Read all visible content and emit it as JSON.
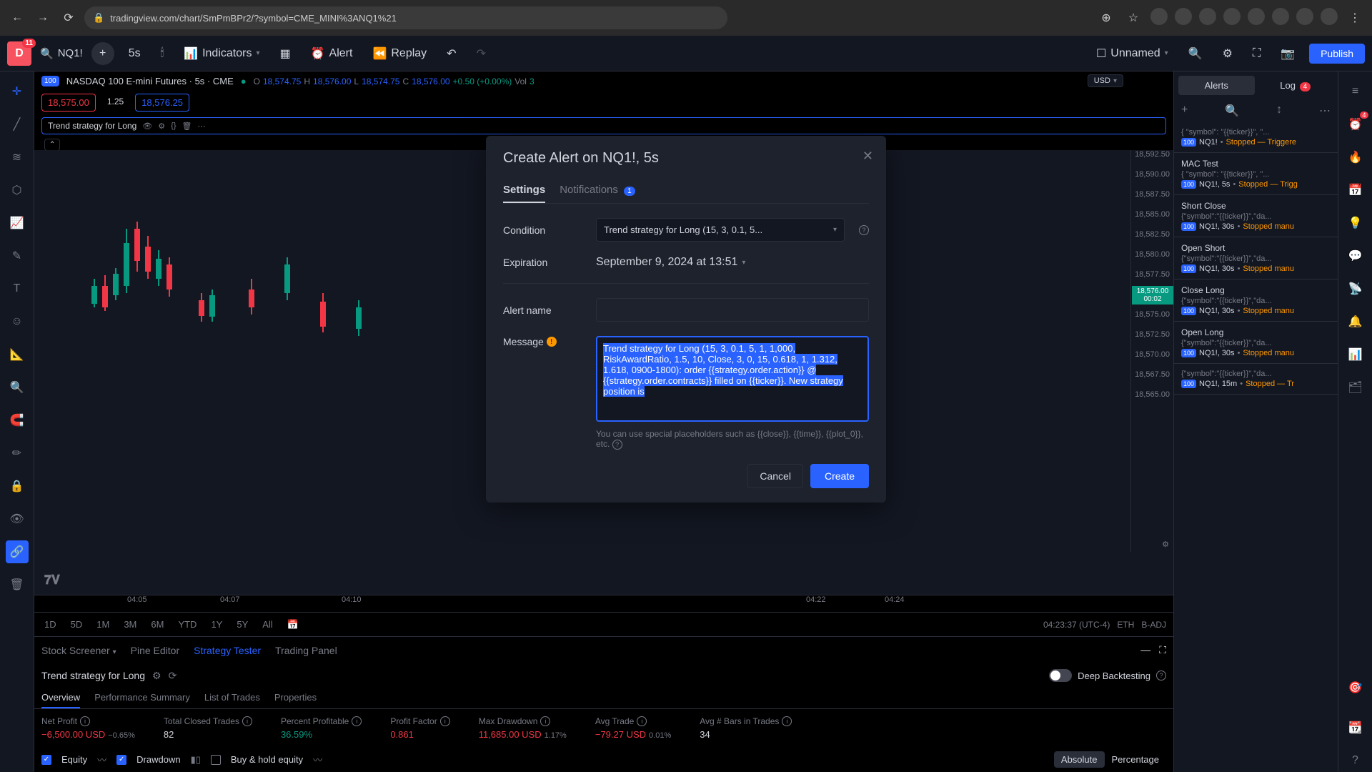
{
  "browser": {
    "url": "tradingview.com/chart/SmPmBPr2/?symbol=CME_MINI%3ANQ1%21"
  },
  "appbar": {
    "avatar_letter": "D",
    "avatar_badge": "11",
    "search_text": "NQ1!",
    "interval": "5s",
    "indicators": "Indicators",
    "alert": "Alert",
    "replay": "Replay",
    "unnamed": "Unnamed",
    "publish": "Publish"
  },
  "symbol": {
    "badge": "100",
    "name": "NASDAQ 100 E-mini Futures · 5s · CME",
    "O": "18,574.75",
    "H": "18,576.00",
    "L": "18,574.75",
    "C": "18,576.00",
    "change": "+0.50 (+0.00%)",
    "vol_label": "Vol",
    "vol": "3",
    "bid": "18,575.00",
    "spread": "1.25",
    "ask": "18,576.25",
    "usd": "USD"
  },
  "strategy_badge": {
    "name": "Trend strategy for Long"
  },
  "price_axis": {
    "ticks": [
      "18,592.50",
      "18,590.00",
      "18,587.50",
      "18,585.00",
      "18,582.50",
      "18,580.00",
      "18,577.50",
      "18,575.00",
      "18,572.50",
      "18,570.00",
      "18,567.50",
      "18,565.00"
    ],
    "live": "18,576.00",
    "countdown": "00:02"
  },
  "time_axis": [
    "04:05",
    "04:07",
    "04:10",
    "04:22",
    "04:24"
  ],
  "footer": {
    "clock": "04:23:37 (UTC-4)",
    "eth": "ETH",
    "badj": "B-ADJ",
    "tfs": [
      "1D",
      "5D",
      "1M",
      "3M",
      "6M",
      "YTD",
      "1Y",
      "5Y",
      "All"
    ]
  },
  "tabs": {
    "stock_screener": "Stock Screener",
    "pine_editor": "Pine Editor",
    "strategy_tester": "Strategy Tester",
    "trading_panel": "Trading Panel"
  },
  "tester": {
    "title": "Trend strategy for Long",
    "deep": "Deep Backtesting",
    "subtabs": {
      "overview": "Overview",
      "perf": "Performance Summary",
      "trades": "List of Trades",
      "props": "Properties"
    },
    "metrics": {
      "net_profit_label": "Net Profit",
      "net_profit": "−6,500.00 USD",
      "net_profit_pct": "−0.65%",
      "closed_trades_label": "Total Closed Trades",
      "closed_trades": "82",
      "pct_profitable_label": "Percent Profitable",
      "pct_profitable": "36.59%",
      "profit_factor_label": "Profit Factor",
      "profit_factor": "0.861",
      "max_dd_label": "Max Drawdown",
      "max_dd": "11,685.00 USD",
      "max_dd_pct": "1.17%",
      "avg_trade_label": "Avg Trade",
      "avg_trade": "−79.27 USD",
      "avg_trade_pct": "0.01%",
      "avg_bars_label": "Avg # Bars in Trades",
      "avg_bars": "34"
    },
    "equity": "Equity",
    "drawdown": "Drawdown",
    "buyhold": "Buy & hold equity",
    "absolute": "Absolute",
    "percentage": "Percentage"
  },
  "alerts": {
    "tab_alerts": "Alerts",
    "tab_log": "Log",
    "log_count": "4",
    "items": [
      {
        "title": "",
        "json": "{ \"symbol\": \"{{ticker}}\", \"...",
        "ticker": "NQ1!",
        "status": "Stopped — Triggere"
      },
      {
        "title": "MAC Test",
        "json": "{ \"symbol\": \"{{ticker}}\", \"...",
        "ticker": "NQ1!, 5s",
        "status": "Stopped — Trigg"
      },
      {
        "title": "Short Close",
        "json": "{\"symbol\":\"{{ticker}}\",\"da...",
        "ticker": "NQ1!, 30s",
        "status": "Stopped manu"
      },
      {
        "title": "Open Short",
        "json": "{\"symbol\":\"{{ticker}}\",\"da...",
        "ticker": "NQ1!, 30s",
        "status": "Stopped manu"
      },
      {
        "title": "Close Long",
        "json": "{\"symbol\":\"{{ticker}}\",\"da...",
        "ticker": "NQ1!, 30s",
        "status": "Stopped manu"
      },
      {
        "title": "Open Long",
        "json": "{\"symbol\":\"{{ticker}}\",\"da...",
        "ticker": "NQ1!, 30s",
        "status": "Stopped manu"
      },
      {
        "title": "",
        "json": "{\"symbol\":\"{{ticker}}\",\"da...",
        "ticker": "NQ1!, 15m",
        "status": "Stopped — Tr"
      }
    ]
  },
  "modal": {
    "title": "Create Alert on NQ1!, 5s",
    "settings": "Settings",
    "notifications": "Notifications",
    "notif_count": "1",
    "condition_label": "Condition",
    "condition_value": "Trend strategy for Long (15, 3, 0.1, 5...",
    "expiration_label": "Expiration",
    "expiration_value": "September 9, 2024 at 13:51",
    "alertname_label": "Alert name",
    "alertname_value": "",
    "message_label": "Message",
    "message_value": "Trend strategy for Long (15, 3, 0.1, 5, 1, 1,000, RiskAwardRatio, 1.5, 10, Close, 3, 0, 15, 0.618, 1, 1.312, 1.618, 0900-1800): order {{strategy.order.action}} @ {{strategy.order.contracts}} filled on {{ticker}}. New strategy position is",
    "hint": "You can use special placeholders such as {{close}}, {{time}}, {{plot_0}}, etc.",
    "cancel": "Cancel",
    "create": "Create"
  },
  "right_toolbar": {
    "alert_badge": "4"
  }
}
